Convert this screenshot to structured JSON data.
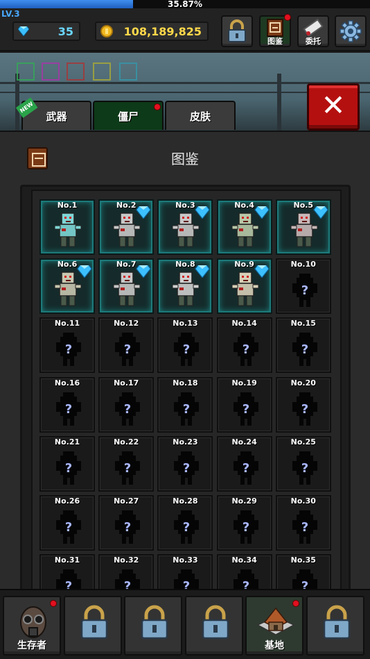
{
  "player": {
    "level": "LV.3",
    "xp_percent": "35.87%",
    "xp_fraction": 0.3587
  },
  "currency": {
    "gems": "35",
    "gold": "108,189,825"
  },
  "top_buttons": [
    {
      "icon": "lock-icon",
      "label": ""
    },
    {
      "icon": "book-icon",
      "label": "图鉴",
      "badge": true
    },
    {
      "icon": "scroll-icon",
      "label": "委托"
    },
    {
      "icon": "gear-icon",
      "label": ""
    }
  ],
  "tabs": [
    {
      "label": "武器",
      "new": true
    },
    {
      "label": "僵尸",
      "active": true,
      "badge": true
    },
    {
      "label": "皮肤"
    }
  ],
  "new_tag": "NEW",
  "close_label": "✕",
  "panel": {
    "title": "图鉴"
  },
  "zombies": [
    {
      "label": "No.1",
      "unlocked": true,
      "gem": false,
      "color": "#7fd6d6"
    },
    {
      "label": "No.2",
      "unlocked": true,
      "gem": true,
      "color": "#c8c8c8"
    },
    {
      "label": "No.3",
      "unlocked": true,
      "gem": true,
      "color": "#c8c8c8"
    },
    {
      "label": "No.4",
      "unlocked": true,
      "gem": true,
      "color": "#b8c8a8"
    },
    {
      "label": "No.5",
      "unlocked": true,
      "gem": true,
      "color": "#c8b8b8"
    },
    {
      "label": "No.6",
      "unlocked": true,
      "gem": true,
      "color": "#c8c8b0"
    },
    {
      "label": "No.7",
      "unlocked": true,
      "gem": true,
      "color": "#c8c8c8"
    },
    {
      "label": "No.8",
      "unlocked": true,
      "gem": true,
      "color": "#d0d0d0"
    },
    {
      "label": "No.9",
      "unlocked": true,
      "gem": true,
      "color": "#d8d0b8"
    },
    {
      "label": "No.10",
      "unlocked": false
    },
    {
      "label": "No.11",
      "unlocked": false
    },
    {
      "label": "No.12",
      "unlocked": false
    },
    {
      "label": "No.13",
      "unlocked": false
    },
    {
      "label": "No.14",
      "unlocked": false
    },
    {
      "label": "No.15",
      "unlocked": false
    },
    {
      "label": "No.16",
      "unlocked": false
    },
    {
      "label": "No.17",
      "unlocked": false
    },
    {
      "label": "No.18",
      "unlocked": false
    },
    {
      "label": "No.19",
      "unlocked": false
    },
    {
      "label": "No.20",
      "unlocked": false
    },
    {
      "label": "No.21",
      "unlocked": false
    },
    {
      "label": "No.22",
      "unlocked": false
    },
    {
      "label": "No.23",
      "unlocked": false
    },
    {
      "label": "No.24",
      "unlocked": false
    },
    {
      "label": "No.25",
      "unlocked": false
    },
    {
      "label": "No.26",
      "unlocked": false
    },
    {
      "label": "No.27",
      "unlocked": false
    },
    {
      "label": "No.28",
      "unlocked": false
    },
    {
      "label": "No.29",
      "unlocked": false
    },
    {
      "label": "No.30",
      "unlocked": false
    },
    {
      "label": "No.31",
      "unlocked": false
    },
    {
      "label": "No.32",
      "unlocked": false
    },
    {
      "label": "No.33",
      "unlocked": false
    },
    {
      "label": "No.34",
      "unlocked": false
    },
    {
      "label": "No.35",
      "unlocked": false
    }
  ],
  "bottom_nav": [
    {
      "label": "生存者",
      "icon": "gas-mask-icon",
      "badge": true
    },
    {
      "label": "",
      "icon": "lock-icon"
    },
    {
      "label": "",
      "icon": "lock-icon"
    },
    {
      "label": "",
      "icon": "lock-icon"
    },
    {
      "label": "基地",
      "icon": "house-icon",
      "badge": true,
      "active": true
    },
    {
      "label": "",
      "icon": "lock-icon"
    }
  ],
  "colors": {
    "accent_blue": "#48a9ff",
    "gold": "#ffd84a",
    "gem": "#6ad7ff",
    "unlocked_glow": "#1fa0a0",
    "close_red": "#b51010",
    "badge_red": "#e01020"
  }
}
